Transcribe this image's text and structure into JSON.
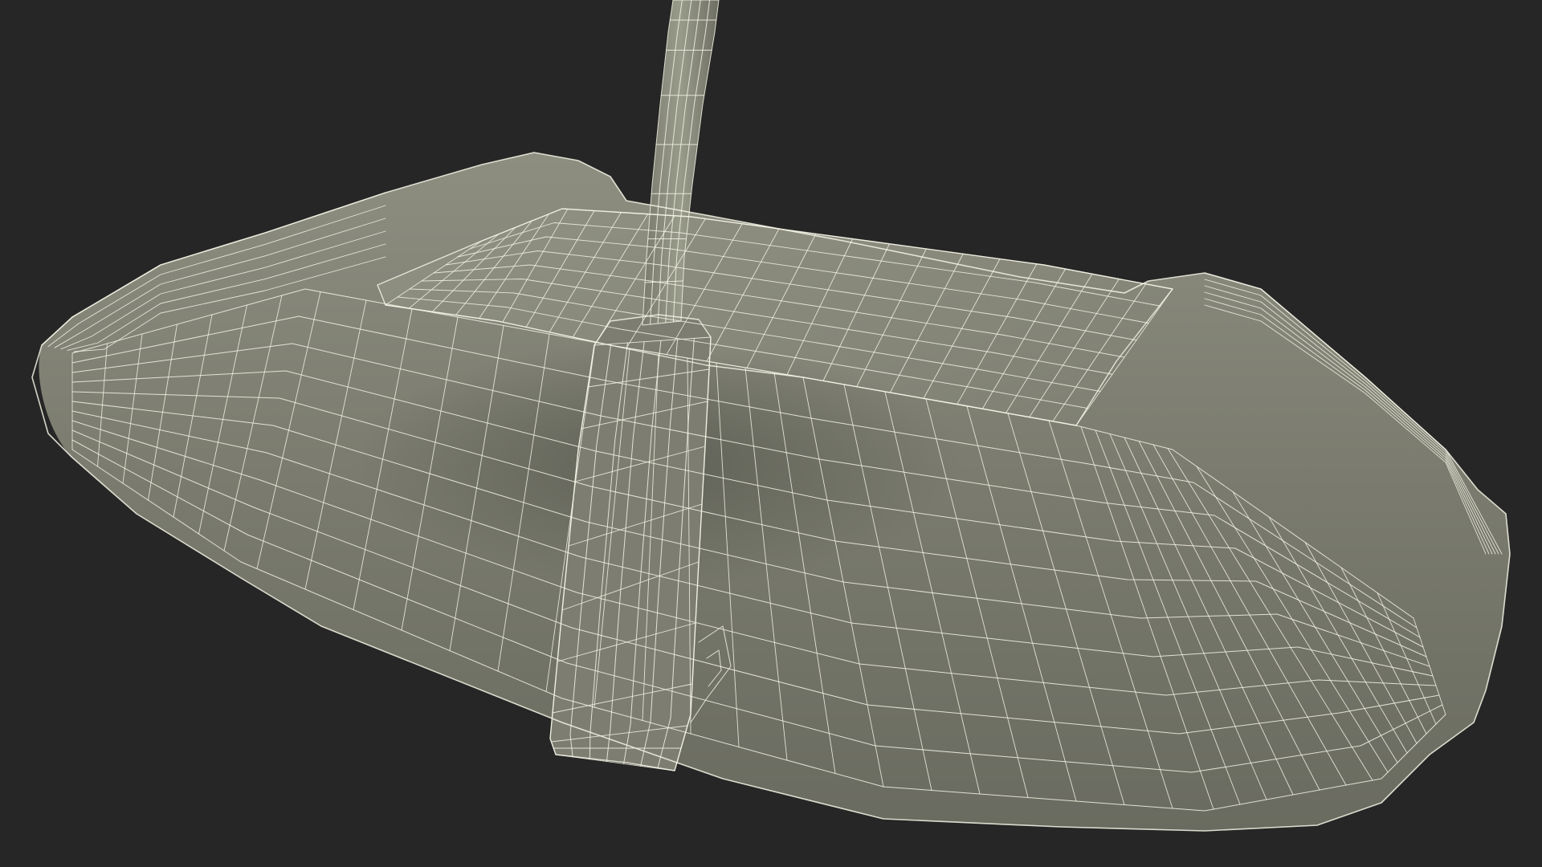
{
  "scene": {
    "subject": "",
    "colors": {
      "background": "#262626",
      "surface_light": "#8a8b7c",
      "surface_mid": "#7b7c6e",
      "surface_dark": "#5f6056",
      "wireframe": "#f4f4e6"
    }
  }
}
